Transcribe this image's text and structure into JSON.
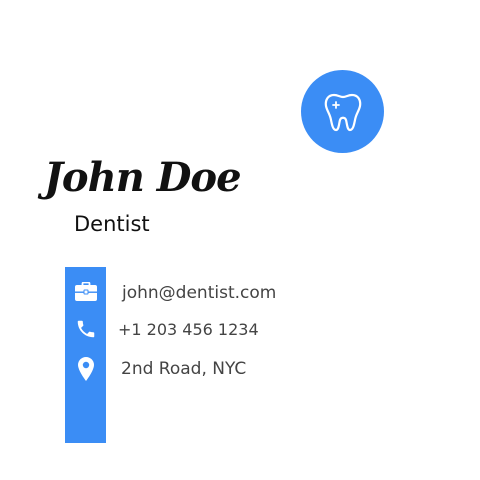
{
  "card": {
    "name": "John Doe",
    "title": "Dentist",
    "logo_icon": "tooth-icon",
    "accent_color": "#3b8df5"
  },
  "contacts": [
    {
      "icon": "briefcase-icon",
      "text": "john@dentist.com"
    },
    {
      "icon": "phone-icon",
      "text": "+1 203 456 1234"
    },
    {
      "icon": "location-pin-icon",
      "text": "2nd Road, NYC"
    }
  ]
}
